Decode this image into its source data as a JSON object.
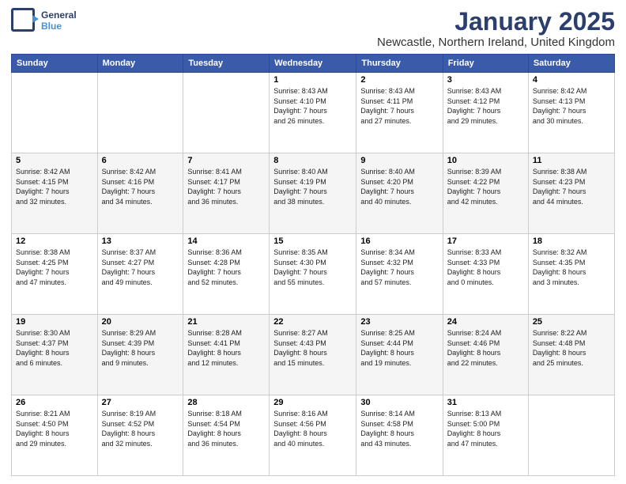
{
  "header": {
    "logo_line1": "General",
    "logo_line2": "Blue",
    "month": "January 2025",
    "location": "Newcastle, Northern Ireland, United Kingdom"
  },
  "weekdays": [
    "Sunday",
    "Monday",
    "Tuesday",
    "Wednesday",
    "Thursday",
    "Friday",
    "Saturday"
  ],
  "weeks": [
    [
      {
        "day": "",
        "info": ""
      },
      {
        "day": "",
        "info": ""
      },
      {
        "day": "",
        "info": ""
      },
      {
        "day": "1",
        "info": "Sunrise: 8:43 AM\nSunset: 4:10 PM\nDaylight: 7 hours\nand 26 minutes."
      },
      {
        "day": "2",
        "info": "Sunrise: 8:43 AM\nSunset: 4:11 PM\nDaylight: 7 hours\nand 27 minutes."
      },
      {
        "day": "3",
        "info": "Sunrise: 8:43 AM\nSunset: 4:12 PM\nDaylight: 7 hours\nand 29 minutes."
      },
      {
        "day": "4",
        "info": "Sunrise: 8:42 AM\nSunset: 4:13 PM\nDaylight: 7 hours\nand 30 minutes."
      }
    ],
    [
      {
        "day": "5",
        "info": "Sunrise: 8:42 AM\nSunset: 4:15 PM\nDaylight: 7 hours\nand 32 minutes."
      },
      {
        "day": "6",
        "info": "Sunrise: 8:42 AM\nSunset: 4:16 PM\nDaylight: 7 hours\nand 34 minutes."
      },
      {
        "day": "7",
        "info": "Sunrise: 8:41 AM\nSunset: 4:17 PM\nDaylight: 7 hours\nand 36 minutes."
      },
      {
        "day": "8",
        "info": "Sunrise: 8:40 AM\nSunset: 4:19 PM\nDaylight: 7 hours\nand 38 minutes."
      },
      {
        "day": "9",
        "info": "Sunrise: 8:40 AM\nSunset: 4:20 PM\nDaylight: 7 hours\nand 40 minutes."
      },
      {
        "day": "10",
        "info": "Sunrise: 8:39 AM\nSunset: 4:22 PM\nDaylight: 7 hours\nand 42 minutes."
      },
      {
        "day": "11",
        "info": "Sunrise: 8:38 AM\nSunset: 4:23 PM\nDaylight: 7 hours\nand 44 minutes."
      }
    ],
    [
      {
        "day": "12",
        "info": "Sunrise: 8:38 AM\nSunset: 4:25 PM\nDaylight: 7 hours\nand 47 minutes."
      },
      {
        "day": "13",
        "info": "Sunrise: 8:37 AM\nSunset: 4:27 PM\nDaylight: 7 hours\nand 49 minutes."
      },
      {
        "day": "14",
        "info": "Sunrise: 8:36 AM\nSunset: 4:28 PM\nDaylight: 7 hours\nand 52 minutes."
      },
      {
        "day": "15",
        "info": "Sunrise: 8:35 AM\nSunset: 4:30 PM\nDaylight: 7 hours\nand 55 minutes."
      },
      {
        "day": "16",
        "info": "Sunrise: 8:34 AM\nSunset: 4:32 PM\nDaylight: 7 hours\nand 57 minutes."
      },
      {
        "day": "17",
        "info": "Sunrise: 8:33 AM\nSunset: 4:33 PM\nDaylight: 8 hours\nand 0 minutes."
      },
      {
        "day": "18",
        "info": "Sunrise: 8:32 AM\nSunset: 4:35 PM\nDaylight: 8 hours\nand 3 minutes."
      }
    ],
    [
      {
        "day": "19",
        "info": "Sunrise: 8:30 AM\nSunset: 4:37 PM\nDaylight: 8 hours\nand 6 minutes."
      },
      {
        "day": "20",
        "info": "Sunrise: 8:29 AM\nSunset: 4:39 PM\nDaylight: 8 hours\nand 9 minutes."
      },
      {
        "day": "21",
        "info": "Sunrise: 8:28 AM\nSunset: 4:41 PM\nDaylight: 8 hours\nand 12 minutes."
      },
      {
        "day": "22",
        "info": "Sunrise: 8:27 AM\nSunset: 4:43 PM\nDaylight: 8 hours\nand 15 minutes."
      },
      {
        "day": "23",
        "info": "Sunrise: 8:25 AM\nSunset: 4:44 PM\nDaylight: 8 hours\nand 19 minutes."
      },
      {
        "day": "24",
        "info": "Sunrise: 8:24 AM\nSunset: 4:46 PM\nDaylight: 8 hours\nand 22 minutes."
      },
      {
        "day": "25",
        "info": "Sunrise: 8:22 AM\nSunset: 4:48 PM\nDaylight: 8 hours\nand 25 minutes."
      }
    ],
    [
      {
        "day": "26",
        "info": "Sunrise: 8:21 AM\nSunset: 4:50 PM\nDaylight: 8 hours\nand 29 minutes."
      },
      {
        "day": "27",
        "info": "Sunrise: 8:19 AM\nSunset: 4:52 PM\nDaylight: 8 hours\nand 32 minutes."
      },
      {
        "day": "28",
        "info": "Sunrise: 8:18 AM\nSunset: 4:54 PM\nDaylight: 8 hours\nand 36 minutes."
      },
      {
        "day": "29",
        "info": "Sunrise: 8:16 AM\nSunset: 4:56 PM\nDaylight: 8 hours\nand 40 minutes."
      },
      {
        "day": "30",
        "info": "Sunrise: 8:14 AM\nSunset: 4:58 PM\nDaylight: 8 hours\nand 43 minutes."
      },
      {
        "day": "31",
        "info": "Sunrise: 8:13 AM\nSunset: 5:00 PM\nDaylight: 8 hours\nand 47 minutes."
      },
      {
        "day": "",
        "info": ""
      }
    ]
  ]
}
